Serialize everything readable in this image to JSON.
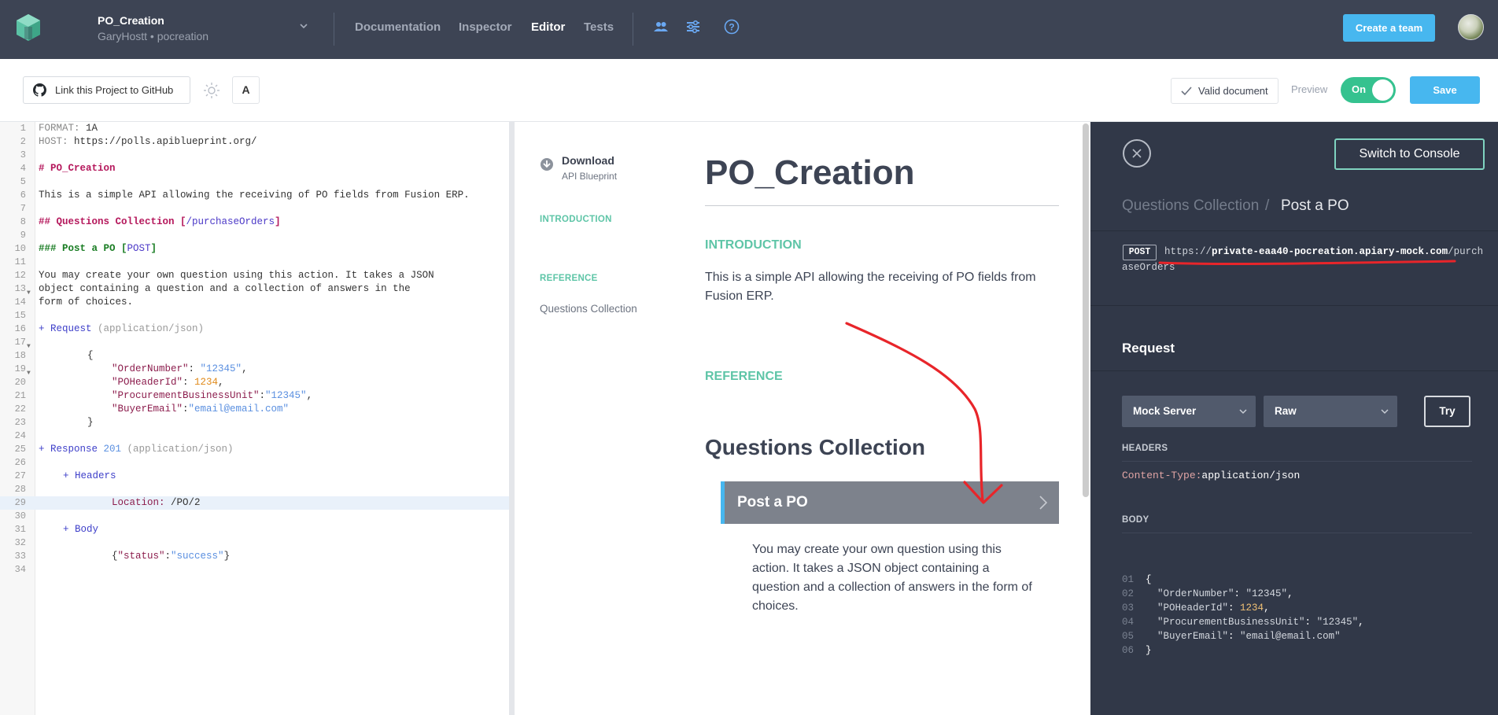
{
  "topbar": {
    "project_name": "PO_Creation",
    "project_sub": "GaryHostt • pocreation",
    "nav": [
      "Documentation",
      "Inspector",
      "Editor",
      "Tests"
    ],
    "active_nav": "Editor",
    "create_team": "Create a team",
    "icons": [
      "team-icon",
      "sliders-icon",
      "help-icon"
    ]
  },
  "toolbar": {
    "github_button": "Link this Project to GitHub",
    "font_button": "A",
    "valid": "Valid document",
    "preview_label": "Preview",
    "toggle": "On",
    "save": "Save"
  },
  "editor": {
    "line_numbers": [
      "1",
      "2",
      "3",
      "4",
      "5",
      "6",
      "7",
      "8",
      "9",
      "10",
      "11",
      "12",
      "13",
      "14",
      "15",
      "16",
      "17",
      "18",
      "19",
      "20",
      "21",
      "22",
      "23",
      "24",
      "25",
      "26",
      "27",
      "28",
      "29",
      "30",
      "31",
      "32",
      "33",
      "34"
    ],
    "l1_key": "FORMAT:",
    "l1_val": " 1A",
    "l2_key": "HOST:",
    "l2_val": " https://polls.apiblueprint.org/",
    "l4": "# PO_Creation",
    "l6": "This is a simple API allowing the receiving of PO fields from Fusion ERP.",
    "l8_a": "## Questions Collection [",
    "l8_b": "/purchaseOrders",
    "l8_c": "]",
    "l10_a": "### Post a PO [",
    "l10_b": "POST",
    "l10_c": "]",
    "l12": "You may create your own question using this action. It takes a JSON",
    "l13": "object containing a question and a collection of answers in the",
    "l14": "form of choices.",
    "l16_a": "+ Request",
    "l16_b": " (application/json)",
    "l18": "{",
    "l19_k": "\"OrderNumber\"",
    "l19_s": ": ",
    "l19_v": "\"12345\"",
    "l19_e": ",",
    "l20_k": "\"POHeaderId\"",
    "l20_s": ": ",
    "l20_v": "1234",
    "l20_e": ",",
    "l21_k": "\"ProcurementBusinessUnit\"",
    "l21_s": ":",
    "l21_v": "\"12345\"",
    "l21_e": ",",
    "l22_k": "\"BuyerEmail\"",
    "l22_s": ":",
    "l22_v": "\"email@email.com\"",
    "l23": "}",
    "l25_a": "+ Response",
    "l25_b": " 201",
    "l25_c": " (application/json)",
    "l27": "+ Headers",
    "l29_k": "Location:",
    "l29_v": " /PO/2",
    "l31": "+ Body",
    "l33_a": "{",
    "l33_k": "\"status\"",
    "l33_s": ":",
    "l33_v": "\"success\"",
    "l33_e": "}"
  },
  "preview": {
    "download_title": "Download",
    "download_sub": "API Blueprint",
    "side_intro": "INTRODUCTION",
    "side_reference": "REFERENCE",
    "side_item": "Questions Collection",
    "title": "PO_Creation",
    "intro_heading": "INTRODUCTION",
    "intro_text": "This is a simple API allowing the receiving of PO fields from Fusion ERP.",
    "reference_heading": "REFERENCE",
    "collection_title": "Questions Collection",
    "action_label": "Post a PO",
    "action_desc": "You may create your own question using this action. It takes a JSON object containing a question and a collection of answers in the form of choices."
  },
  "console": {
    "switch": "Switch to Console",
    "crumb_1": "Questions Collection",
    "crumb_sep": "/",
    "crumb_2": "Post a PO",
    "method": "POST",
    "url_prefix": "https://",
    "url_host": "private-eaa40-pocreation.apiary-mock.com",
    "url_path_1": "/purch",
    "url_path_2": "aseOrders",
    "request_title": "Request",
    "mock_select": "Mock Server",
    "raw_select": "Raw",
    "try": "Try",
    "headers_label": "HEADERS",
    "header_key": "Content-Type:",
    "header_val": "application/json",
    "body_label": "BODY",
    "body_lines": [
      {
        "n": "01",
        "t": "{"
      },
      {
        "n": "02",
        "k": "  \"OrderNumber\"",
        "s": ": ",
        "v": "\"12345\"",
        "e": ","
      },
      {
        "n": "03",
        "k": "  \"POHeaderId\"",
        "s": ": ",
        "v": "1234",
        "e": ","
      },
      {
        "n": "04",
        "k": "  \"ProcurementBusinessUnit\"",
        "s": ": ",
        "v": "\"12345\"",
        "e": ","
      },
      {
        "n": "05",
        "k": "  \"BuyerEmail\"",
        "s": ": ",
        "v": "\"email@email.com\"",
        "e": ""
      },
      {
        "n": "06",
        "t": "}"
      }
    ]
  },
  "colors": {
    "topbar": "#3d4454",
    "accent": "#47b7ef",
    "teal": "#5ec5a7",
    "console_bg": "#313848",
    "annotation": "#e8252a"
  }
}
